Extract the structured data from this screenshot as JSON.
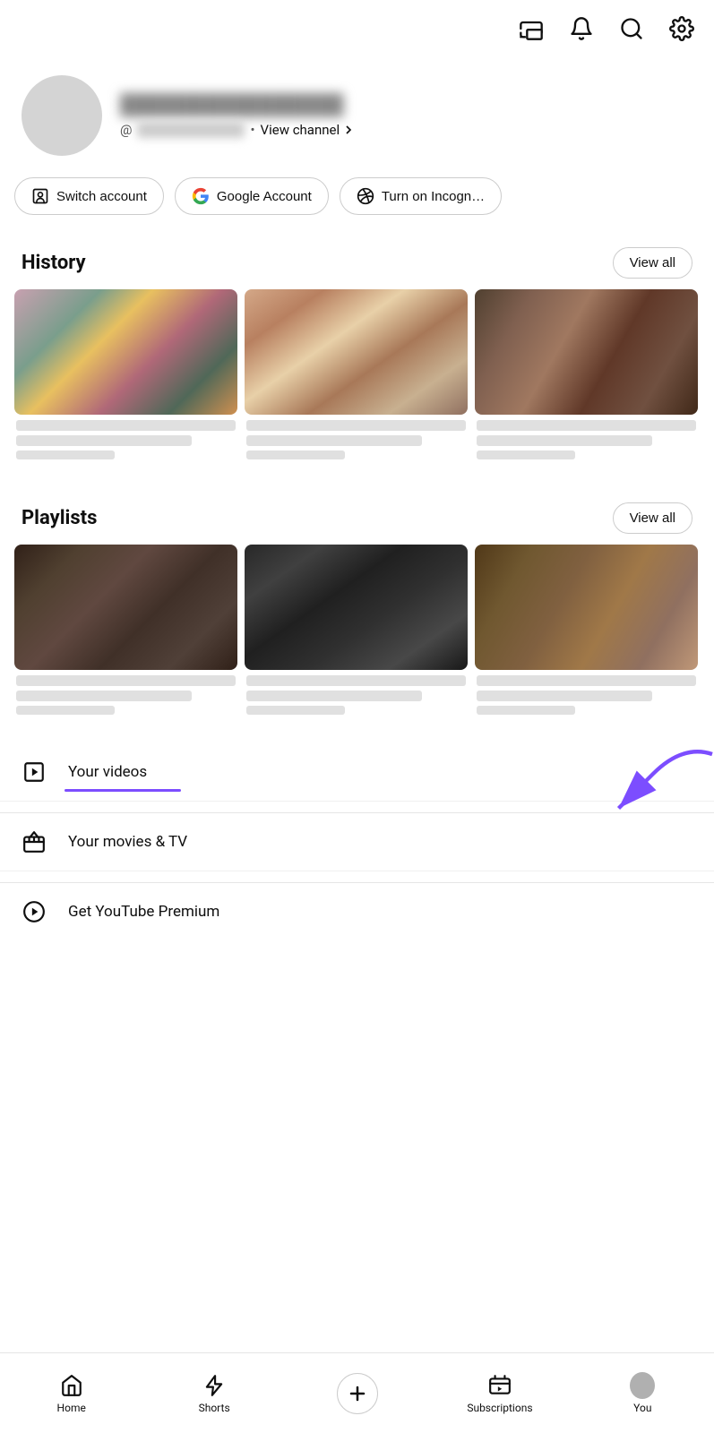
{
  "topbar": {
    "cast_label": "cast",
    "bell_label": "notifications",
    "search_label": "search",
    "settings_label": "settings"
  },
  "profile": {
    "name_blurred": "████████████████",
    "handle_prefix": "@",
    "handle_blurred": "██████████",
    "view_channel_label": "View channel"
  },
  "action_buttons": [
    {
      "id": "switch-account",
      "label": "Switch account",
      "icon": "person-switch"
    },
    {
      "id": "google-account",
      "label": "Google Account",
      "icon": "google-g"
    },
    {
      "id": "incognito",
      "label": "Turn on Incogn…",
      "icon": "incognito"
    }
  ],
  "history": {
    "title": "History",
    "view_all": "View all",
    "thumbnails": [
      {
        "id": "hist-1",
        "style_class": "thumb-hist-1"
      },
      {
        "id": "hist-2",
        "style_class": "thumb-hist-2"
      },
      {
        "id": "hist-3",
        "style_class": "thumb-hist-3"
      }
    ]
  },
  "playlists": {
    "title": "Playlists",
    "view_all": "View all",
    "thumbnails": [
      {
        "id": "play-1",
        "style_class": "thumb-play-1"
      },
      {
        "id": "play-2",
        "style_class": "thumb-play-2"
      },
      {
        "id": "play-3",
        "style_class": "thumb-play-3"
      }
    ]
  },
  "menu_items": [
    {
      "id": "your-videos",
      "label": "Your videos",
      "icon": "play-square",
      "annotated": true
    },
    {
      "id": "your-movies-tv",
      "label": "Your movies & TV",
      "icon": "clapperboard"
    },
    {
      "id": "youtube-premium",
      "label": "Get YouTube Premium",
      "icon": "play-circle"
    }
  ],
  "annotation": {
    "arrow_color": "#7c4dff"
  },
  "bottom_nav": [
    {
      "id": "home",
      "label": "Home",
      "icon": "home"
    },
    {
      "id": "shorts",
      "label": "Shorts",
      "icon": "shorts"
    },
    {
      "id": "create",
      "label": "",
      "icon": "plus"
    },
    {
      "id": "subscriptions",
      "label": "Subscriptions",
      "icon": "subscriptions"
    },
    {
      "id": "you",
      "label": "You",
      "icon": "you-avatar"
    }
  ]
}
